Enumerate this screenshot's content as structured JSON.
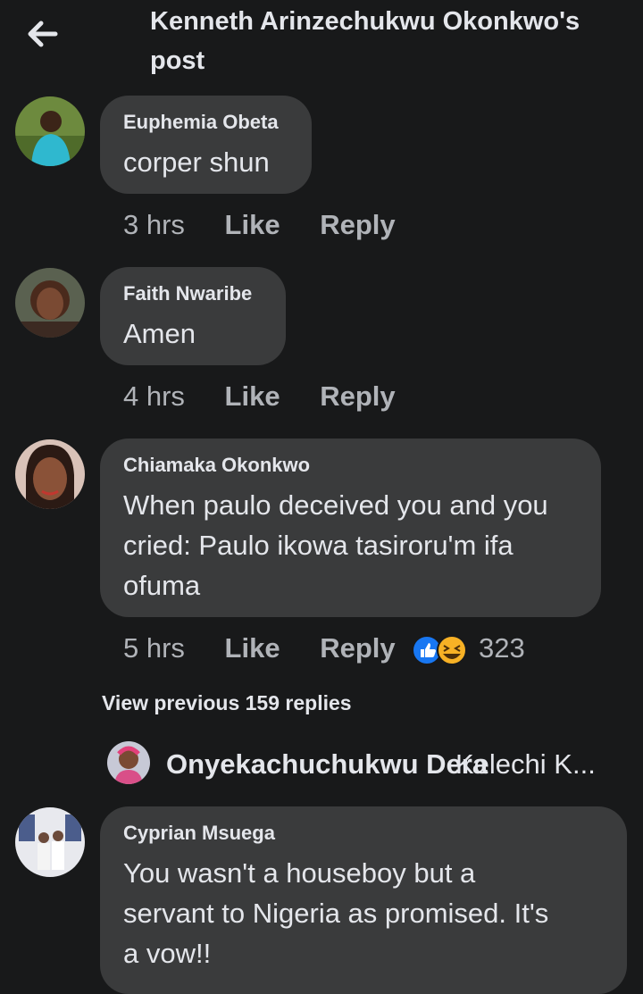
{
  "header": {
    "title": "Kenneth Arinzechukwu Okonkwo's post"
  },
  "comments": [
    {
      "author": "Euphemia Obeta",
      "text": "corper shun",
      "time": "3 hrs",
      "like": "Like",
      "reply": "Reply"
    },
    {
      "author": "Faith Nwaribe",
      "text": "Amen",
      "time": "4 hrs",
      "like": "Like",
      "reply": "Reply"
    },
    {
      "author": "Chiamaka Okonkwo",
      "text": "When paulo deceived you and you cried: Paulo ikowa tasiroru'm ifa ofuma",
      "time": "5 hrs",
      "like": "Like",
      "reply": "Reply",
      "reaction_count": "323",
      "reaction_icons": [
        "like-reaction-icon",
        "laugh-reaction-icon"
      ]
    },
    {
      "author": "Cyprian Msuega",
      "text": "You wasn't a houseboy but a servant to Nigeria as promised. It's a vow!!"
    }
  ],
  "view_previous": "View previous 159 replies",
  "reply_preview": {
    "author": "Onyekachuchukwu Dera",
    "snippet": "Kelechi K..."
  },
  "colors": {
    "background": "#18191a",
    "bubble": "#3a3b3c",
    "text": "#e4e6eb",
    "meta": "#b0b3b8",
    "like_blue": "#1877f2",
    "laugh_yellow": "#f7b125"
  }
}
